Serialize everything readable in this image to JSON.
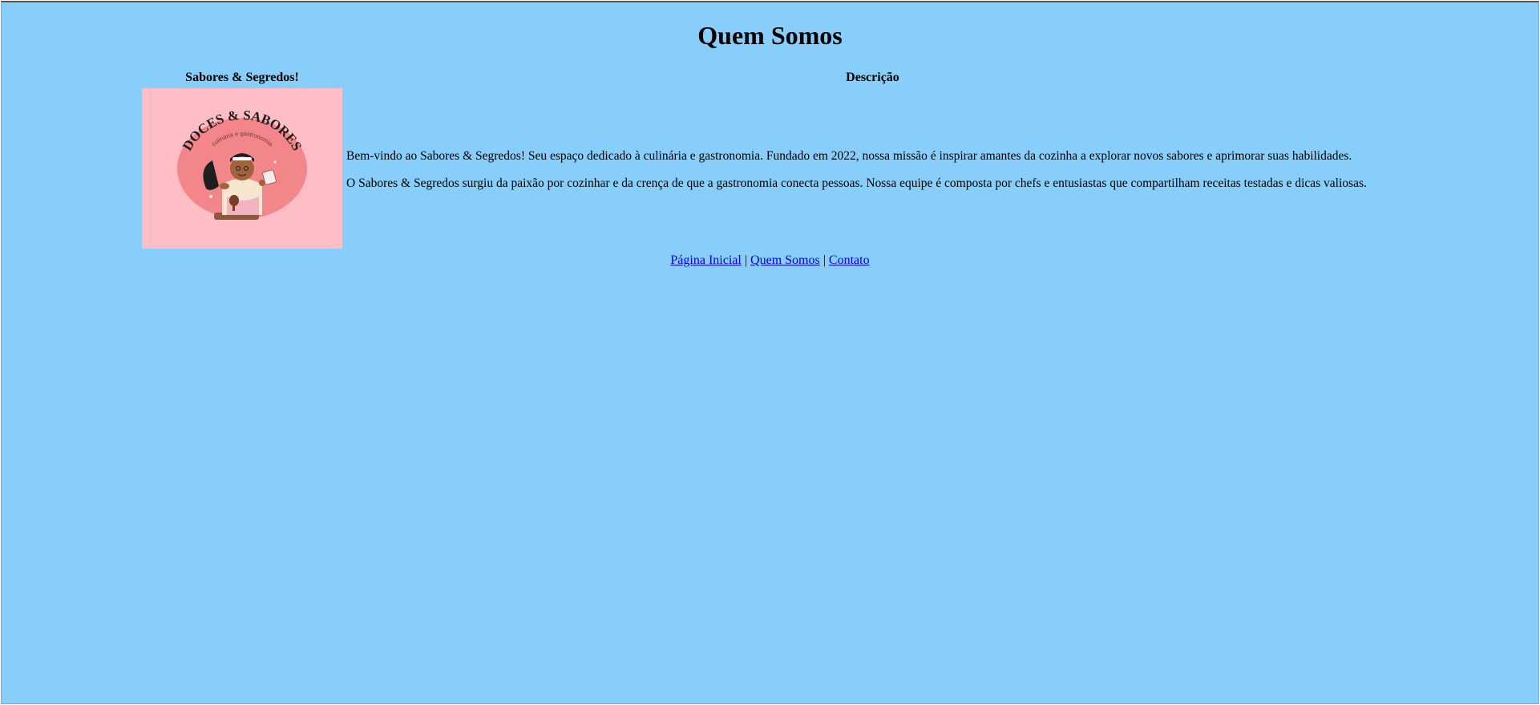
{
  "page": {
    "title": "Quem Somos"
  },
  "table": {
    "headers": [
      "Sabores & Segredos!",
      "Descrição"
    ]
  },
  "logo": {
    "image_label": "logo-doces-e-sabores",
    "arc_text": "DOCES & SABORES",
    "sub_text": "culinária e gastronomia",
    "bg_color": "#ffbec5",
    "circle_color": "#f2868b"
  },
  "description": {
    "paragraphs": [
      "Bem-vindo ao Sabores & Segredos! Seu espaço dedicado à culinária e gastronomia. Fundado em 2022, nossa missão é inspirar amantes da cozinha a explorar novos sabores e aprimorar suas habilidades.",
      "O Sabores & Segredos surgiu da paixão por cozinhar e da crença de que a gastronomia conecta pessoas. Nossa equipe é composta por chefs e entusiastas que compartilham receitas testadas e dicas valiosas."
    ]
  },
  "footer_nav": {
    "links": [
      "Página Inicial",
      "Quem Somos",
      "Contato"
    ],
    "separator": "|"
  },
  "colors": {
    "page_bg": "#87cefa",
    "link": "#0000ee"
  }
}
